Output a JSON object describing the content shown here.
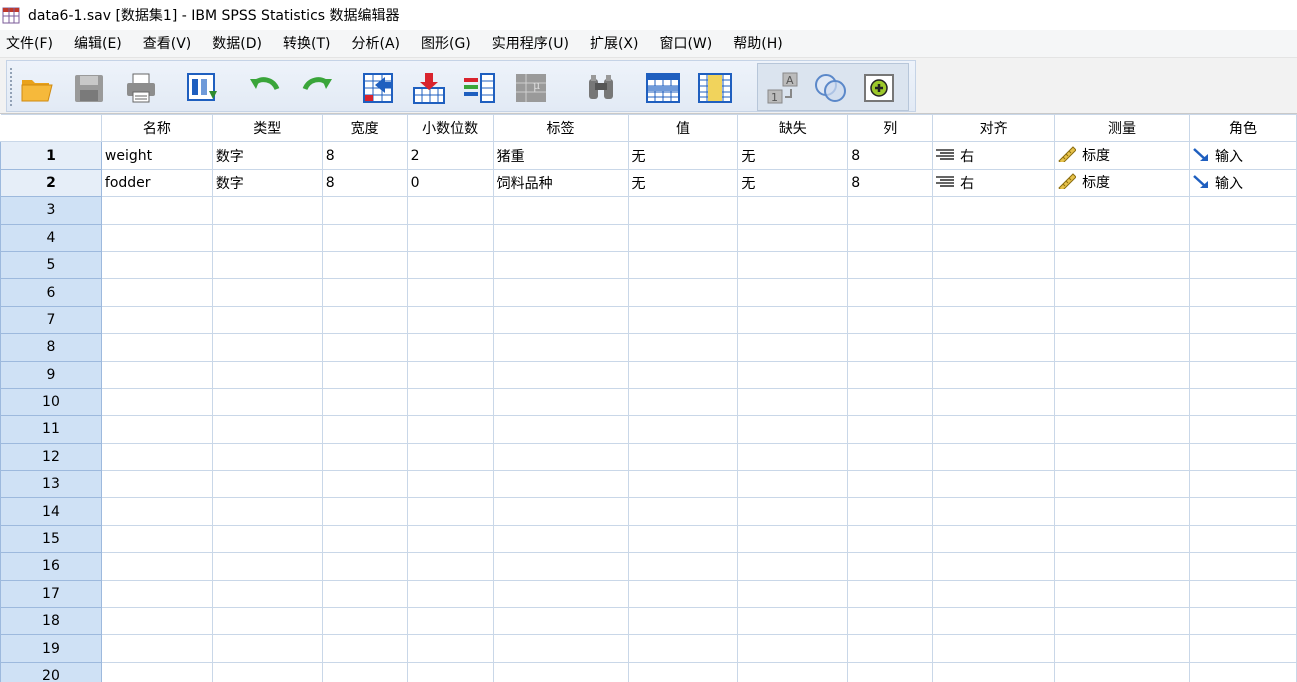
{
  "window": {
    "title": "data6-1.sav [数据集1] - IBM SPSS Statistics 数据编辑器"
  },
  "menu": [
    "文件(F)",
    "编辑(E)",
    "查看(V)",
    "数据(D)",
    "转换(T)",
    "分析(A)",
    "图形(G)",
    "实用程序(U)",
    "扩展(X)",
    "窗口(W)",
    "帮助(H)"
  ],
  "toolbar": {
    "icons": [
      "open-file-icon",
      "save-icon",
      "print-icon",
      "recall-dialog-icon",
      "undo-icon",
      "redo-icon",
      "goto-case-icon",
      "goto-variable-icon",
      "variables-icon",
      "run-descriptives-icon",
      "find-icon",
      "insert-cases-icon",
      "insert-variable-icon",
      "split-file-icon",
      "weight-cases-icon",
      "select-cases-icon",
      "value-labels-icon",
      "use-variable-sets-icon"
    ]
  },
  "grid": {
    "columns": [
      "名称",
      "类型",
      "宽度",
      "小数位数",
      "标签",
      "值",
      "缺失",
      "列",
      "对齐",
      "测量",
      "角色"
    ],
    "rows": [
      {
        "num": "1",
        "name": "weight",
        "type": "数字",
        "width": "8",
        "decimals": "2",
        "label": "猪重",
        "values": "无",
        "missing": "无",
        "columns": "8",
        "align": "右",
        "measure": "标度",
        "role": "输入"
      },
      {
        "num": "2",
        "name": "fodder",
        "type": "数字",
        "width": "8",
        "decimals": "0",
        "label": "饲料品种",
        "values": "无",
        "missing": "无",
        "columns": "8",
        "align": "右",
        "measure": "标度",
        "role": "输入"
      }
    ],
    "empty_row_numbers": [
      "3",
      "4",
      "5",
      "6",
      "7",
      "8",
      "9",
      "10",
      "11",
      "12",
      "13",
      "14",
      "15",
      "16",
      "17",
      "18",
      "19",
      "20"
    ]
  },
  "colors": {
    "rownum_bg": "#cfe1f5",
    "grid_line": "#c9d7e8",
    "toolbar_bg": "#e2eaf5",
    "role_arrow": "#1f5fbf"
  }
}
